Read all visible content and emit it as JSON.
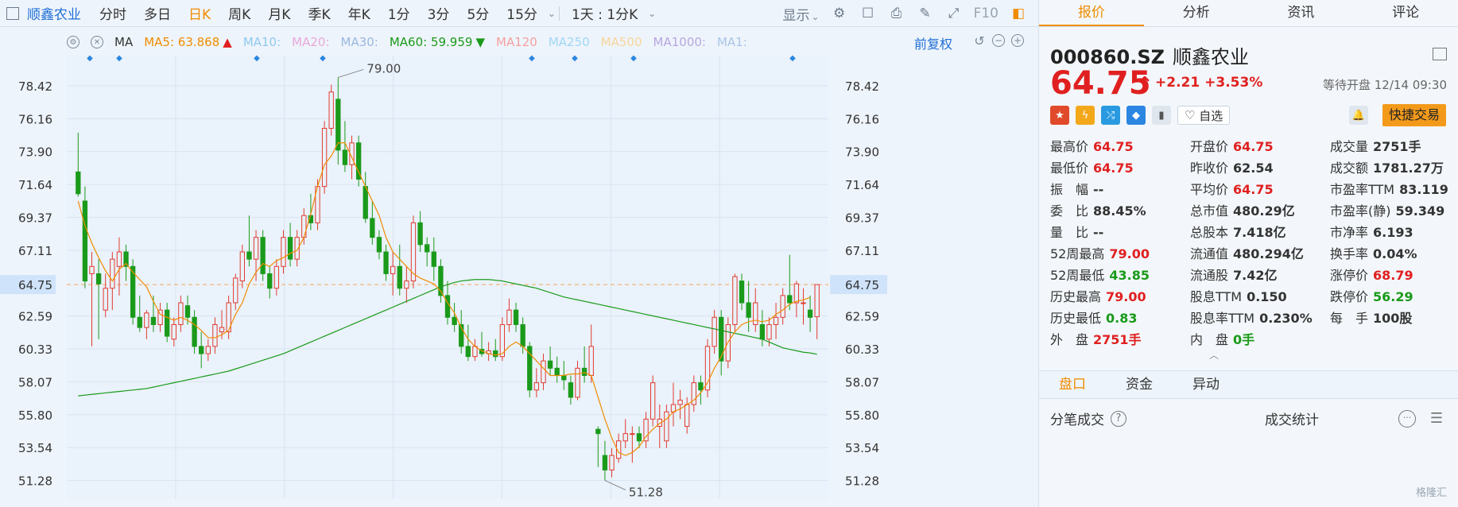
{
  "toolbar": {
    "stock_name": "顺鑫农业",
    "timeframes": [
      "分时",
      "多日",
      "日K",
      "周K",
      "月K",
      "季K",
      "年K",
      "1分",
      "3分",
      "5分",
      "15分"
    ],
    "active_timeframe": "日K",
    "period_select": "1天 : 1分K",
    "display_label": "显示",
    "f10_label": "F10"
  },
  "ma_bar": {
    "ma_label": "MA",
    "ma5": "MA5: 63.868",
    "ma10": "MA10:",
    "ma20": "MA20:",
    "ma30": "MA30:",
    "ma60": "MA60: 59.959",
    "ma120": "MA120",
    "ma250": "MA250",
    "ma500": "MA500",
    "ma1000": "MA1000:",
    "ma1": "MA1:",
    "adjust_label": "前复权",
    "colors": {
      "ma5": "#f08c00",
      "ma10": "#8ec9f0",
      "ma20": "#e8a8d8",
      "ma30": "#9ab8e0",
      "ma60": "#1a9a1a",
      "ma120": "#f4a0a0",
      "ma250": "#9fd8f4",
      "ma500": "#f6d59a",
      "ma1000": "#b7a6e0",
      "ma1": "#a8c4e6"
    }
  },
  "chart_data": {
    "type": "candlestick",
    "y_ticks": [
      "78.42",
      "76.16",
      "73.90",
      "71.64",
      "69.37",
      "67.11",
      "64.75",
      "62.59",
      "60.33",
      "58.07",
      "55.80",
      "53.54",
      "51.28"
    ],
    "ylim": [
      50.0,
      80.5
    ],
    "current_price_label": "64.75",
    "high_annotation": "79.00",
    "low_annotation": "51.28",
    "candles": [
      [
        72.5,
        75.2,
        70.8,
        71.0
      ],
      [
        70.5,
        71.5,
        64.5,
        65.0
      ],
      [
        65.5,
        67.0,
        60.5,
        66.0
      ],
      [
        65.5,
        66.5,
        61.0,
        64.8
      ],
      [
        63.0,
        65.5,
        62.5,
        64.5
      ],
      [
        64.5,
        67.0,
        63.0,
        66.5
      ],
      [
        66.0,
        68.0,
        64.0,
        67.0
      ],
      [
        67.0,
        67.5,
        65.0,
        66.0
      ],
      [
        66.0,
        66.5,
        62.0,
        62.5
      ],
      [
        62.5,
        64.0,
        61.5,
        61.8
      ],
      [
        61.8,
        63.0,
        61.0,
        62.8
      ],
      [
        62.5,
        64.0,
        61.5,
        62.0
      ],
      [
        62.0,
        63.5,
        61.5,
        63.0
      ],
      [
        63.0,
        63.5,
        60.8,
        61.2
      ],
      [
        61.0,
        62.5,
        60.5,
        62.0
      ],
      [
        62.0,
        64.0,
        61.5,
        63.5
      ],
      [
        63.3,
        64.0,
        62.0,
        62.5
      ],
      [
        62.5,
        63.0,
        60.0,
        60.5
      ],
      [
        60.5,
        61.5,
        59.0,
        60.0
      ],
      [
        60.0,
        61.0,
        59.5,
        60.5
      ],
      [
        60.5,
        62.5,
        60.0,
        62.0
      ],
      [
        61.5,
        63.0,
        61.0,
        61.8
      ],
      [
        61.5,
        64.0,
        61.0,
        63.5
      ],
      [
        63.5,
        65.5,
        63.0,
        65.2
      ],
      [
        65.0,
        67.5,
        64.5,
        67.0
      ],
      [
        67.0,
        69.5,
        66.0,
        66.5
      ],
      [
        66.5,
        68.5,
        65.0,
        68.0
      ],
      [
        68.0,
        68.5,
        65.0,
        65.5
      ],
      [
        65.5,
        66.0,
        63.8,
        64.5
      ],
      [
        64.5,
        66.5,
        64.0,
        66.0
      ],
      [
        66.0,
        68.5,
        65.5,
        68.0
      ],
      [
        68.0,
        69.0,
        66.0,
        66.5
      ],
      [
        66.5,
        68.5,
        66.0,
        68.0
      ],
      [
        68.0,
        70.0,
        67.5,
        69.5
      ],
      [
        69.5,
        71.0,
        68.5,
        69.0
      ],
      [
        69.0,
        72.0,
        68.5,
        71.5
      ],
      [
        71.5,
        76.0,
        71.0,
        75.5
      ],
      [
        75.5,
        78.5,
        75.0,
        78.0
      ],
      [
        77.5,
        79.0,
        73.0,
        74.0
      ],
      [
        74.0,
        76.0,
        72.5,
        73.0
      ],
      [
        73.0,
        75.0,
        72.0,
        74.5
      ],
      [
        74.5,
        75.0,
        71.5,
        72.0
      ],
      [
        71.5,
        72.5,
        69.0,
        69.3
      ],
      [
        69.3,
        70.5,
        67.5,
        68.0
      ],
      [
        68.0,
        68.5,
        66.5,
        67.0
      ],
      [
        67.0,
        67.5,
        65.0,
        65.5
      ],
      [
        65.5,
        67.0,
        64.0,
        66.0
      ],
      [
        66.0,
        67.5,
        64.0,
        64.5
      ],
      [
        64.5,
        66.0,
        63.5,
        65.0
      ],
      [
        65.0,
        69.5,
        64.5,
        69.0
      ],
      [
        69.0,
        69.8,
        67.0,
        67.5
      ],
      [
        67.5,
        68.0,
        66.0,
        67.0
      ],
      [
        67.0,
        68.0,
        65.0,
        66.0
      ],
      [
        66.0,
        66.5,
        63.5,
        64.0
      ],
      [
        64.0,
        65.0,
        62.0,
        62.5
      ],
      [
        62.5,
        63.5,
        61.5,
        62.0
      ],
      [
        62.0,
        63.0,
        60.0,
        60.5
      ],
      [
        60.5,
        62.0,
        59.5,
        59.8
      ],
      [
        59.8,
        61.0,
        59.5,
        60.5
      ],
      [
        60.3,
        61.5,
        59.8,
        60.0
      ],
      [
        60.0,
        60.8,
        59.5,
        60.2
      ],
      [
        60.2,
        61.0,
        59.5,
        59.8
      ],
      [
        59.8,
        62.5,
        59.5,
        62.0
      ],
      [
        62.0,
        63.8,
        61.5,
        63.0
      ],
      [
        63.0,
        63.5,
        61.5,
        62.0
      ],
      [
        62.0,
        62.5,
        60.0,
        60.5
      ],
      [
        60.5,
        60.8,
        57.0,
        57.5
      ],
      [
        57.5,
        59.0,
        57.0,
        58.0
      ],
      [
        58.0,
        60.0,
        57.5,
        59.5
      ],
      [
        59.5,
        60.5,
        58.5,
        59.0
      ],
      [
        59.0,
        59.8,
        58.0,
        58.5
      ],
      [
        58.5,
        59.5,
        57.5,
        58.2
      ],
      [
        58.0,
        58.5,
        56.5,
        57.0
      ],
      [
        57.0,
        59.5,
        56.8,
        59.0
      ],
      [
        59.0,
        60.5,
        58.0,
        58.5
      ],
      [
        58.5,
        62.0,
        58.0,
        60.5
      ],
      [
        54.8,
        55.0,
        52.2,
        54.5
      ],
      [
        53.0,
        54.0,
        51.28,
        52.0
      ],
      [
        52.0,
        53.5,
        51.5,
        53.0
      ],
      [
        52.8,
        54.5,
        52.5,
        54.0
      ],
      [
        54.0,
        55.5,
        53.5,
        54.5
      ],
      [
        54.5,
        55.0,
        52.5,
        54.5
      ],
      [
        54.5,
        55.0,
        53.5,
        54.0
      ],
      [
        54.0,
        56.0,
        53.5,
        55.5
      ],
      [
        55.5,
        58.5,
        55.0,
        58.0
      ],
      [
        55.0,
        56.5,
        53.5,
        55.5
      ],
      [
        54.0,
        56.5,
        53.5,
        56.0
      ],
      [
        56.0,
        58.0,
        55.0,
        56.5
      ],
      [
        56.5,
        57.5,
        55.5,
        56.8
      ],
      [
        55.0,
        57.0,
        54.5,
        56.5
      ],
      [
        56.5,
        58.5,
        56.0,
        58.0
      ],
      [
        58.0,
        58.5,
        56.5,
        57.5
      ],
      [
        57.5,
        61.0,
        57.0,
        60.5
      ],
      [
        60.5,
        63.0,
        60.0,
        62.5
      ],
      [
        62.5,
        63.0,
        58.5,
        59.5
      ],
      [
        59.5,
        62.5,
        59.0,
        62.0
      ],
      [
        62.0,
        65.5,
        61.5,
        65.3
      ],
      [
        65.0,
        65.5,
        63.0,
        63.5
      ],
      [
        63.5,
        65.0,
        61.5,
        62.5
      ],
      [
        62.0,
        64.5,
        61.5,
        63.5
      ],
      [
        62.0,
        63.0,
        60.5,
        61.0
      ],
      [
        61.0,
        62.5,
        60.5,
        62.0
      ],
      [
        62.0,
        63.5,
        61.0,
        62.5
      ],
      [
        62.5,
        64.5,
        62.0,
        64.0
      ],
      [
        64.0,
        66.8,
        63.0,
        63.5
      ],
      [
        63.5,
        65.0,
        62.5,
        64.8
      ],
      [
        63.5,
        64.5,
        62.0,
        63.5
      ],
      [
        63.0,
        64.0,
        61.5,
        62.5
      ],
      [
        62.54,
        64.75,
        61.0,
        64.75
      ]
    ],
    "ma5": [
      70.5,
      68.8,
      67.6,
      66.6,
      65.7,
      65.0,
      65.8,
      66.2,
      65.6,
      65.1,
      64.6,
      63.6,
      62.7,
      62.5,
      62.3,
      62.5,
      62.3,
      62.0,
      61.6,
      61.1,
      61.1,
      61.3,
      61.6,
      62.7,
      63.5,
      64.8,
      65.6,
      66.2,
      66.0,
      66.4,
      66.6,
      66.9,
      67.1,
      68.0,
      69.6,
      71.5,
      73.0,
      73.6,
      74.5,
      74.5,
      73.5,
      72.5,
      71.5,
      70.5,
      69.5,
      68.0,
      67.0,
      66.5,
      66.0,
      65.5,
      65.2,
      65.0,
      64.8,
      64.3,
      63.5,
      62.8,
      61.8,
      61.0,
      60.5,
      60.2,
      60.0,
      59.9,
      60.0,
      60.5,
      60.8,
      60.5,
      60.0,
      59.5,
      59.0,
      58.5,
      58.5,
      58.5,
      58.6,
      58.6,
      58.7,
      58.5,
      57.0,
      55.5,
      54.2,
      53.2,
      53.0,
      53.2,
      53.6,
      54.3,
      54.8,
      55.2,
      55.5,
      56.0,
      56.2,
      56.5,
      56.8,
      57.3,
      58.0,
      59.0,
      59.8,
      60.8,
      61.5,
      62.0,
      62.2,
      62.3,
      62.2,
      62.3,
      62.7,
      63.0,
      63.4,
      63.6,
      63.7,
      63.87
    ],
    "ma60": [
      57.1,
      57.15,
      57.2,
      57.25,
      57.3,
      57.35,
      57.4,
      57.45,
      57.5,
      57.55,
      57.6,
      57.7,
      57.8,
      57.9,
      58.0,
      58.1,
      58.2,
      58.3,
      58.4,
      58.5,
      58.6,
      58.7,
      58.8,
      58.95,
      59.1,
      59.25,
      59.4,
      59.55,
      59.7,
      59.85,
      60.0,
      60.2,
      60.4,
      60.6,
      60.8,
      61.0,
      61.2,
      61.4,
      61.6,
      61.8,
      62.0,
      62.2,
      62.4,
      62.6,
      62.8,
      63.0,
      63.2,
      63.4,
      63.6,
      63.8,
      64.0,
      64.2,
      64.4,
      64.6,
      64.75,
      64.9,
      65.0,
      65.05,
      65.1,
      65.1,
      65.1,
      65.05,
      65.0,
      64.9,
      64.8,
      64.7,
      64.6,
      64.5,
      64.35,
      64.2,
      64.05,
      63.9,
      63.8,
      63.7,
      63.6,
      63.5,
      63.4,
      63.3,
      63.2,
      63.1,
      63.0,
      62.9,
      62.8,
      62.7,
      62.6,
      62.5,
      62.4,
      62.3,
      62.2,
      62.1,
      62.0,
      61.9,
      61.8,
      61.7,
      61.6,
      61.5,
      61.4,
      61.3,
      61.2,
      61.1,
      61.0,
      60.8,
      60.6,
      60.4,
      60.3,
      60.2,
      60.1,
      60.05,
      59.959
    ]
  },
  "panel": {
    "tabs": [
      "报价",
      "分析",
      "资讯",
      "评论"
    ],
    "active_tab": "报价",
    "code": "000860.SZ",
    "name": "顺鑫农业",
    "price": "64.75",
    "change": "+2.21",
    "change_pct": "+3.53%",
    "status": "等待开盘 12/14 09:30",
    "zixuan_label": "自选",
    "quick_trade_label": "快捷交易",
    "badges": [
      {
        "icon": "china-flag-icon",
        "color": "#e04a2a",
        "glyph": "★"
      },
      {
        "icon": "lightning-icon",
        "color": "#f3a81c",
        "glyph": "ϟ"
      },
      {
        "icon": "shuffle-icon",
        "color": "#2a9ae0",
        "glyph": "⤮"
      },
      {
        "icon": "tag-icon",
        "color": "#2a86e0",
        "glyph": "◆"
      },
      {
        "icon": "bookmark-icon",
        "color": "#dfe6ee",
        "glyph": "▮"
      }
    ],
    "stats": [
      {
        "label": "最高价",
        "value": "64.75",
        "tone": "up"
      },
      {
        "label": "开盘价",
        "value": "64.75",
        "tone": "up"
      },
      {
        "label": "成交量",
        "value": "2751手",
        "tone": "flat"
      },
      {
        "label": "最低价",
        "value": "64.75",
        "tone": "up"
      },
      {
        "label": "昨收价",
        "value": "62.54",
        "tone": "flat"
      },
      {
        "label": "成交额",
        "value": "1781.27万",
        "tone": "flat"
      },
      {
        "label": "振　幅",
        "value": "--",
        "tone": "flat"
      },
      {
        "label": "平均价",
        "value": "64.75",
        "tone": "up"
      },
      {
        "label": "市盈率TTM",
        "value": "83.119",
        "tone": "flat"
      },
      {
        "label": "委　比",
        "value": "88.45%",
        "tone": "flat"
      },
      {
        "label": "总市值",
        "value": "480.29亿",
        "tone": "flat"
      },
      {
        "label": "市盈率(静)",
        "value": "59.349",
        "tone": "flat"
      },
      {
        "label": "量　比",
        "value": "--",
        "tone": "flat"
      },
      {
        "label": "总股本",
        "value": "7.418亿",
        "tone": "flat"
      },
      {
        "label": "市净率",
        "value": "6.193",
        "tone": "flat"
      },
      {
        "label": "52周最高",
        "value": "79.00",
        "tone": "up"
      },
      {
        "label": "流通值",
        "value": "480.294亿",
        "tone": "flat"
      },
      {
        "label": "换手率",
        "value": "0.04%",
        "tone": "flat"
      },
      {
        "label": "52周最低",
        "value": "43.85",
        "tone": "down"
      },
      {
        "label": "流通股",
        "value": "7.42亿",
        "tone": "flat"
      },
      {
        "label": "涨停价",
        "value": "68.79",
        "tone": "up"
      },
      {
        "label": "历史最高",
        "value": "79.00",
        "tone": "up"
      },
      {
        "label": "股息TTM",
        "value": "0.150",
        "tone": "flat"
      },
      {
        "label": "跌停价",
        "value": "56.29",
        "tone": "down"
      },
      {
        "label": "历史最低",
        "value": "0.83",
        "tone": "down"
      },
      {
        "label": "股息率TTM",
        "value": "0.230%",
        "tone": "flat"
      },
      {
        "label": "每　手",
        "value": "100股",
        "tone": "flat"
      },
      {
        "label": "外　盘",
        "value": "2751手",
        "tone": "up"
      },
      {
        "label": "内　盘",
        "value": "0手",
        "tone": "down"
      }
    ],
    "subtabs": [
      "盘口",
      "资金",
      "异动"
    ],
    "active_subtab": "盘口",
    "trade_label": "分笔成交",
    "trade_stats_label": "成交统计",
    "watermark": "格隆汇"
  }
}
